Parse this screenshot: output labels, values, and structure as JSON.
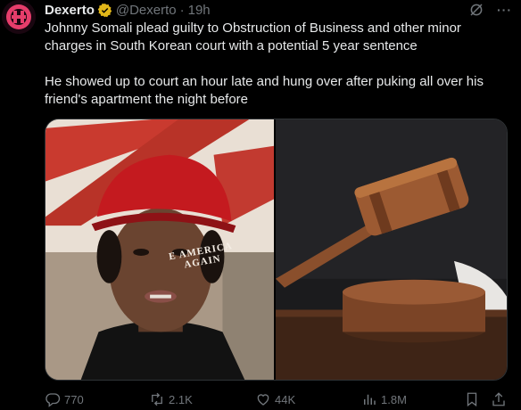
{
  "author": {
    "name": "Dexerto",
    "handle": "@Dexerto",
    "time": "19h",
    "separator": "·"
  },
  "tweet": {
    "paragraph1": "Johnny Somali plead guilty to Obstruction of Business and other minor charges in South Korean court with a potential 5 year sentence",
    "paragraph2": "He showed up to court an hour late and hung over after puking all over his friend's apartment the night before"
  },
  "media": {
    "left_image": "man-wearing-red-cap-photo",
    "right_image": "wooden-gavel-photo",
    "cap_text_line1": "AMERICA",
    "cap_text_line2": "AGAIN",
    "cap_text_prefix": "E"
  },
  "actions": {
    "replies": "770",
    "reposts": "2.1K",
    "likes": "44K",
    "views": "1.8M"
  },
  "colors": {
    "background": "#000000",
    "text": "#e7e9ea",
    "secondary": "#71767b",
    "verified_gold": "#e2b719"
  }
}
